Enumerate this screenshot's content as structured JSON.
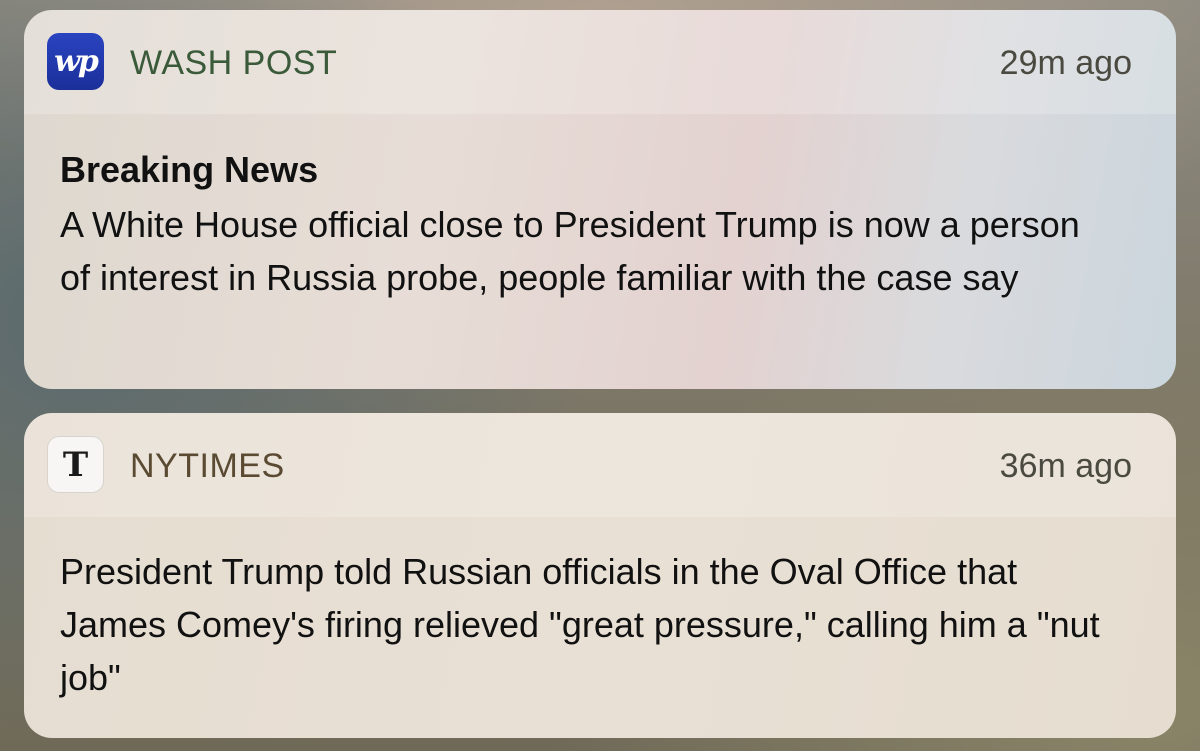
{
  "notifications": [
    {
      "app_name": "WASH POST",
      "icon_glyph": "wp",
      "icon": "washington-post-logo-icon",
      "timestamp": "29m ago",
      "title": "Breaking News",
      "body": "A White House official close to President Trump is now a person of interest in Russia probe, people familiar with the case say",
      "colors": {
        "icon_bg": "#1f36a8",
        "app_name": "#3a5a3a"
      }
    },
    {
      "app_name": "NYTIMES",
      "icon_glyph": "T",
      "icon": "new-york-times-logo-icon",
      "timestamp": "36m ago",
      "title": "",
      "body": "President Trump told Russian officials in the Oval Office that James Comey's firing relieved \"great pressure,\" calling him a \"nut job\"",
      "colors": {
        "icon_bg": "#f7f6f4",
        "app_name": "#5a4a32"
      }
    }
  ]
}
